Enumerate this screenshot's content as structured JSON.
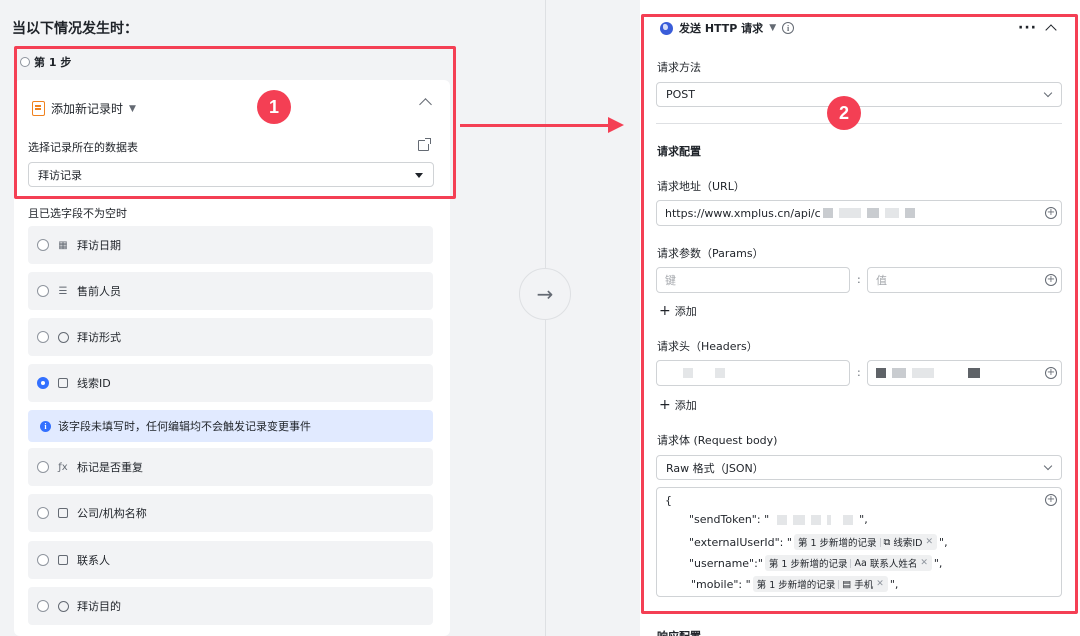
{
  "left": {
    "title": "当以下情况发生时：",
    "step_label": "第 1 步",
    "trigger_label": "添加新记录时",
    "table_label": "选择记录所在的数据表",
    "table_value": "拜访记录",
    "condition_label": "且已选字段不为空时",
    "fields": [
      {
        "label": "拜访日期",
        "icon": "calendar-icon",
        "glyph": "▦"
      },
      {
        "label": "售前人员",
        "icon": "list-icon",
        "glyph": "☰"
      },
      {
        "label": "拜访形式",
        "icon": "circle-chevron-icon",
        "glyph": "⌄"
      },
      {
        "label": "线索ID",
        "icon": "link-record-icon",
        "glyph": "⧉"
      },
      {
        "label": "标记是否重复",
        "icon": "formula-icon",
        "glyph": "ƒx"
      },
      {
        "label": "公司/机构名称",
        "icon": "text-doc-icon",
        "glyph": "▤"
      },
      {
        "label": "联系人",
        "icon": "text-doc-icon",
        "glyph": "▤"
      },
      {
        "label": "拜访目的",
        "icon": "circle-chevron-icon",
        "glyph": "⌄"
      }
    ],
    "info_text": "该字段未填写时，任何编辑均不会触发记录变更事件"
  },
  "right": {
    "action_label": "发送 HTTP 请求",
    "method_label": "请求方法",
    "method_value": "POST",
    "config_label": "请求配置",
    "url_label": "请求地址（URL）",
    "url_value": "https://www.xmplus.cn/api/c",
    "params_label": "请求参数（Params）",
    "params_key_placeholder": "键",
    "params_value_placeholder": "值",
    "add_label": "添加",
    "headers_label": "请求头（Headers）",
    "body_label": "请求体 (Request body)",
    "body_format": "Raw 格式（JSON）",
    "body": {
      "open_brace": "{",
      "send_token_key": "\"sendToken\": \"",
      "send_token_end": "\",",
      "external_key": "\"externalUserId\": \"",
      "username_key": "\"username\":\"",
      "mobile_key": "\"mobile\": \"",
      "line_end": "\",",
      "tag_prefix": "第 1 步新增的记录",
      "tag_external_field": "线索ID",
      "tag_username_field": "联系人姓名",
      "tag_mobile_field": "手机"
    },
    "next_section_label": "响应配置"
  },
  "annotations": {
    "badge_1": "1",
    "badge_2": "2",
    "color": "#f43f54"
  },
  "colors": {
    "accent": "#3370ff",
    "trigger_icon": "#f0821f"
  }
}
